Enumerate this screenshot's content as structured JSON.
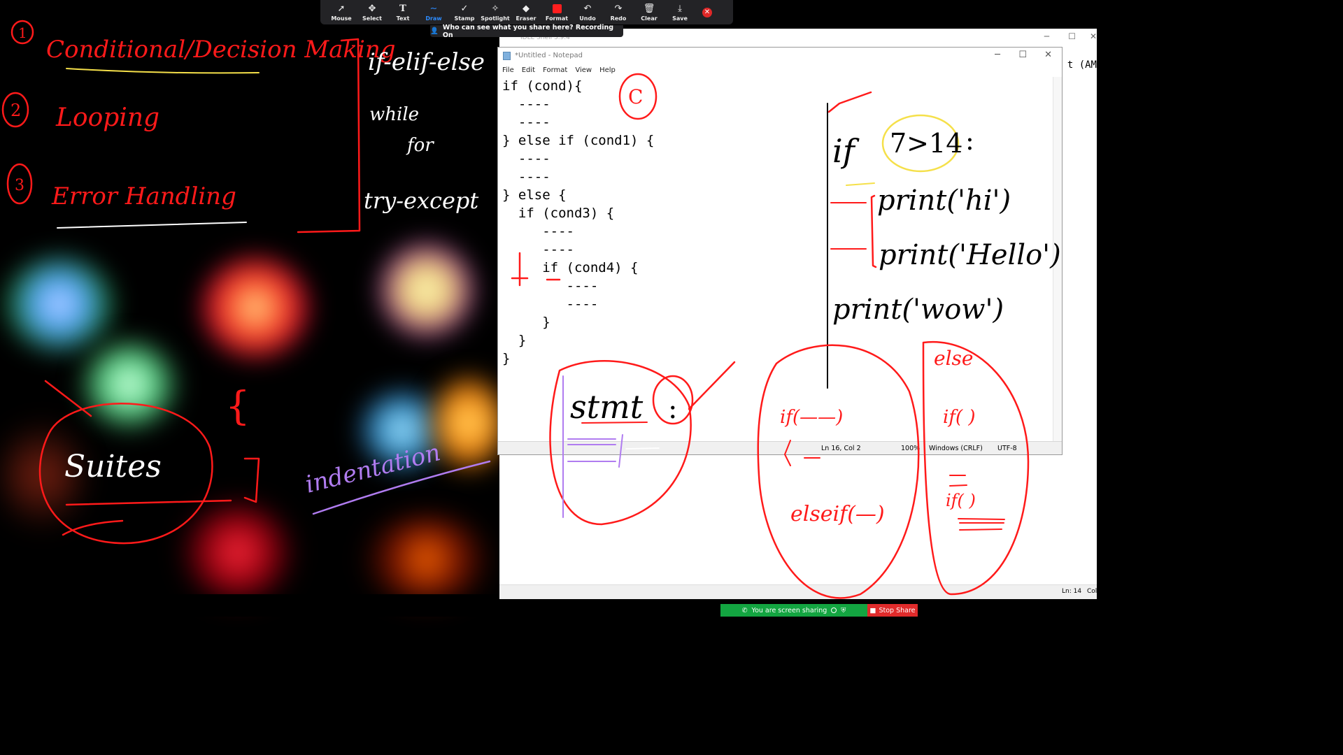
{
  "zoom_toolbar": {
    "tools": [
      {
        "label": "Mouse",
        "icon": "mouse-pointer-icon",
        "glyph": "➚"
      },
      {
        "label": "Select",
        "icon": "select-move-icon",
        "glyph": "✥"
      },
      {
        "label": "Text",
        "icon": "text-icon",
        "glyph": "T"
      },
      {
        "label": "Draw",
        "icon": "draw-squiggle-icon",
        "glyph": "∼",
        "active": true
      },
      {
        "label": "Stamp",
        "icon": "stamp-check-icon",
        "glyph": "✓"
      },
      {
        "label": "Spotlight",
        "icon": "spotlight-wand-icon",
        "glyph": "✧"
      },
      {
        "label": "Eraser",
        "icon": "eraser-icon",
        "glyph": "◆"
      },
      {
        "label": "Format",
        "icon": "format-color-icon",
        "glyph": ""
      },
      {
        "label": "Undo",
        "icon": "undo-icon",
        "glyph": "↶"
      },
      {
        "label": "Redo",
        "icon": "redo-icon",
        "glyph": "↷"
      },
      {
        "label": "Clear",
        "icon": "trash-icon",
        "glyph": "🗑"
      },
      {
        "label": "Save",
        "icon": "save-download-icon",
        "glyph": "⤓"
      }
    ],
    "format_color": "#ff1e1e"
  },
  "share_banner": "Who can see what you share here? Recording On",
  "idle_window": {
    "title": "IDLE Shell 3.9.4",
    "visible_text": "t (AM",
    "status_line": "Ln: 14",
    "status_col": "Col"
  },
  "notepad": {
    "title": "*Untitled - Notepad",
    "menu": [
      "File",
      "Edit",
      "Format",
      "View",
      "Help"
    ],
    "code": "if (cond){\n  ----\n  ----\n} else if (cond1) {\n  ----\n  ----\n} else {\n  if (cond3) {\n     ----\n     ----\n     if (cond4) {\n        ----\n        ----\n     }\n  }\n}",
    "status": {
      "position": "Ln 16, Col 2",
      "zoom": "100%",
      "line_ending": "Windows (CRLF)",
      "encoding": "UTF-8"
    }
  },
  "annotations": {
    "n1": "1",
    "n2": "2",
    "n3": "3",
    "topic1": "Conditional/Decision Making",
    "topic2": "Looping",
    "topic3": "Error Handling",
    "kw1": "if-elif-else",
    "kw2": "while",
    "kw3": "for",
    "kw4": "try-except",
    "c_label": "C",
    "suites": "Suites",
    "brace": "{",
    "indentation": "indentation",
    "stmt": "stmt",
    "colon": ":",
    "py_if": "if",
    "py_cond": "7>14",
    "py_colon": ":",
    "py_print1": "print('hi')",
    "py_print2": "print('Hello')",
    "py_print3": "print('wow')",
    "if_block": "if(——)",
    "elif_block": "elseif(—)",
    "else_block": "else",
    "else_if": "if( )",
    "else_if2": "if( )",
    "ink_red": "#ff1a1a",
    "ink_white": "#ffffff",
    "ink_yellow": "#f5e04a",
    "ink_purple": "#b07cf0"
  },
  "share_pill": {
    "status": "You are screen sharing",
    "stop": "Stop Share"
  }
}
